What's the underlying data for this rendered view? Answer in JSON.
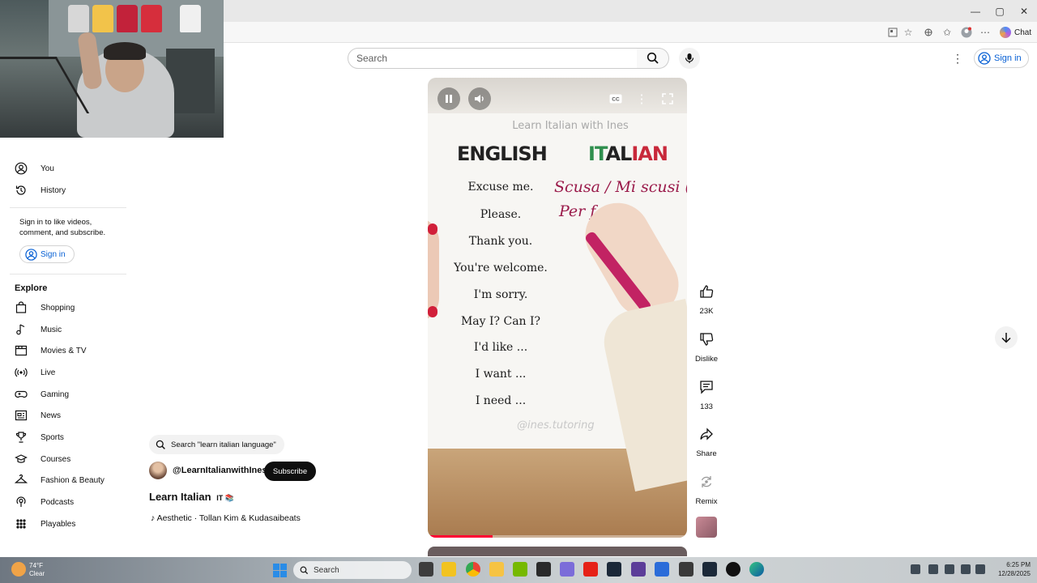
{
  "browser": {
    "window_controls": [
      "—",
      "▢",
      "✕"
    ],
    "chat_label": "Chat"
  },
  "header": {
    "search_placeholder": "Search",
    "sign_in": "Sign in"
  },
  "sidebar": {
    "items_top": [
      {
        "label": "You",
        "icon": "user-circle-icon"
      },
      {
        "label": "History",
        "icon": "history-icon"
      }
    ],
    "signin_message": "Sign in to like videos, comment, and subscribe.",
    "signin_button": "Sign in",
    "explore_heading": "Explore",
    "explore_items": [
      {
        "label": "Shopping",
        "icon": "shopping-bag-icon"
      },
      {
        "label": "Music",
        "icon": "music-note-icon"
      },
      {
        "label": "Movies & TV",
        "icon": "film-icon"
      },
      {
        "label": "Live",
        "icon": "live-icon"
      },
      {
        "label": "Gaming",
        "icon": "gamepad-icon"
      },
      {
        "label": "News",
        "icon": "newspaper-icon"
      },
      {
        "label": "Sports",
        "icon": "trophy-icon"
      },
      {
        "label": "Courses",
        "icon": "courses-icon"
      },
      {
        "label": "Fashion & Beauty",
        "icon": "hanger-icon"
      },
      {
        "label": "Podcasts",
        "icon": "podcast-icon"
      },
      {
        "label": "Playables",
        "icon": "playables-icon"
      }
    ]
  },
  "video": {
    "credit": "Learn Italian with Ines",
    "heading_english": "ENGLISH",
    "heading_italian": "ITALIAN",
    "english_phrases": [
      "Excuse me.",
      "Please.",
      "Thank you.",
      "You're welcome.",
      "I'm sorry.",
      "May I? Can I?",
      "I'd like ...",
      "I want ...",
      "I need ..."
    ],
    "handwriting_line1": "Scusa / Mi scusi (f)",
    "handwriting_line2": "Per f",
    "watermark": "@ines.tutoring",
    "progress_fraction": 0.25,
    "controls": [
      "pause-icon",
      "volume-icon",
      "captions-icon",
      "more-icon",
      "fullscreen-icon"
    ]
  },
  "actions": {
    "like_count": "23K",
    "dislike_label": "Dislike",
    "comment_count": "133",
    "share_label": "Share",
    "remix_label": "Remix"
  },
  "info": {
    "search_chip": "Search \"learn italian language\"",
    "channel": "@LearnItalianwithInes",
    "subscribe": "Subscribe",
    "title": "Learn Italian",
    "title_emoji": "IT 📚",
    "music": "Aesthetic · Tollan Kim & Kudasaibeats"
  },
  "taskbar": {
    "weather_temp": "74°F",
    "weather_desc": "Clear",
    "search_label": "Search",
    "time": "6:25 PM",
    "date": "12/28/2025"
  },
  "colors": {
    "accent_blue": "#065fd4",
    "italian_green": "#2f8f4e",
    "italian_red": "#c8283a",
    "pen_magenta": "#c22363"
  }
}
